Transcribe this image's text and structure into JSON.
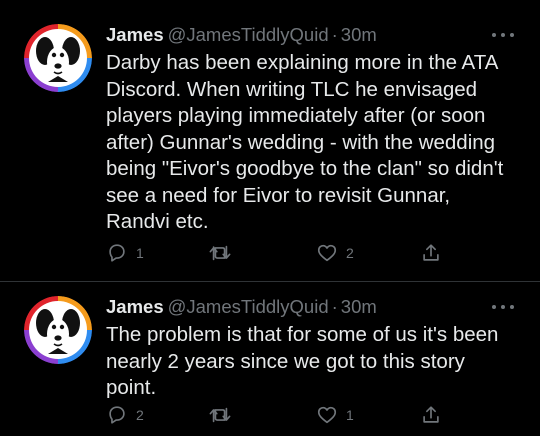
{
  "colors": {
    "background": "#000000",
    "text_primary": "#e7e9ea",
    "text_secondary": "#71767b",
    "divider": "#2f3336"
  },
  "tweets": [
    {
      "display_name": "James",
      "handle": "@JamesTiddlyQuid",
      "separator": "·",
      "time": "30m",
      "more_icon": "more-horizontal-icon",
      "text": "Darby has been explaining more in the ATA Discord. When writing TLC he envisaged players playing immediately after (or soon after) Gunnar's wedding - with the wedding being \"Eivor's goodbye to the clan\" so didn't see a need for Eivor to revisit Gunnar, Randvi etc.",
      "reply_count": "1",
      "retweet_count": "",
      "like_count": "2"
    },
    {
      "display_name": "James",
      "handle": "@JamesTiddlyQuid",
      "separator": "·",
      "time": "30m",
      "more_icon": "more-horizontal-icon",
      "text": "The problem is that for some of us it's been nearly 2 years since we got to this story point.",
      "reply_count": "2",
      "retweet_count": "",
      "like_count": "1"
    }
  ]
}
